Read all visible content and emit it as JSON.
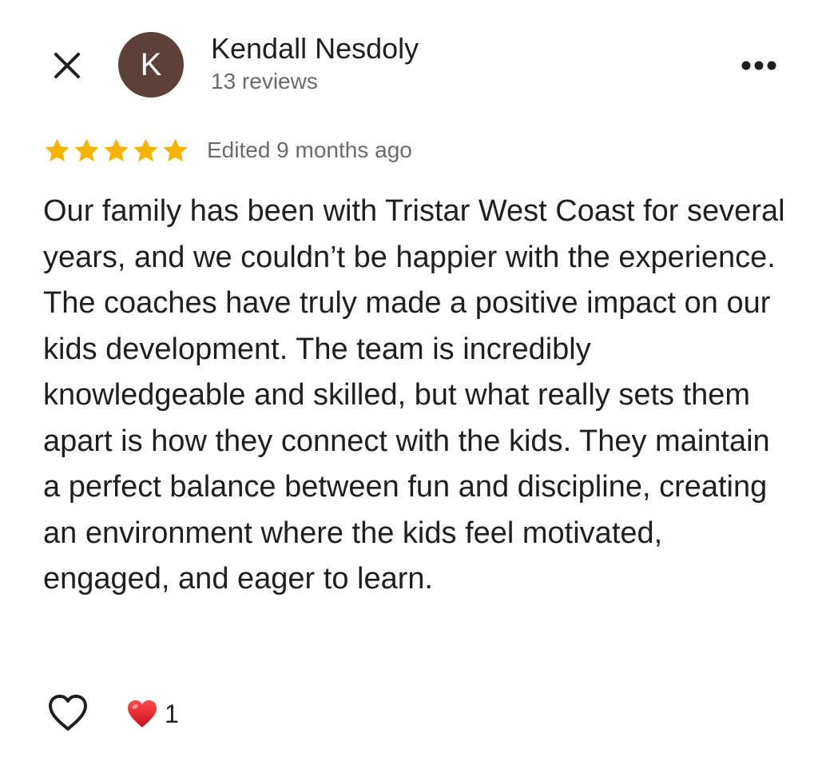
{
  "header": {
    "avatar_letter": "K",
    "author_name": "Kendall Nesdoly",
    "review_count": "13 reviews",
    "close_icon": "close-icon",
    "more_icon": "more-horizontal-icon"
  },
  "rating": {
    "stars": 5,
    "max_stars": 5,
    "edited_text": "Edited 9 months ago",
    "star_color": "#f4b400"
  },
  "review": {
    "text": "Our family has been with Tristar West Coast for several years, and we couldn’t be happier with the experience. The coaches have truly made a positive impact on our kids development. The team is incredibly knowledgeable and skilled, but what really sets them apart is how they connect with the kids. They maintain a perfect balance between fun and discipline, creating an environment where the kids feel motivated, engaged, and eager to learn."
  },
  "footer": {
    "like_icon": "heart-outline-icon",
    "reaction_icon": "red-heart-icon",
    "reaction_count": "1"
  },
  "colors": {
    "avatar_bg": "#5d4037",
    "text_primary": "#1f1f1f",
    "text_secondary": "#6b6b6b",
    "reaction_red": "#e0202e"
  }
}
